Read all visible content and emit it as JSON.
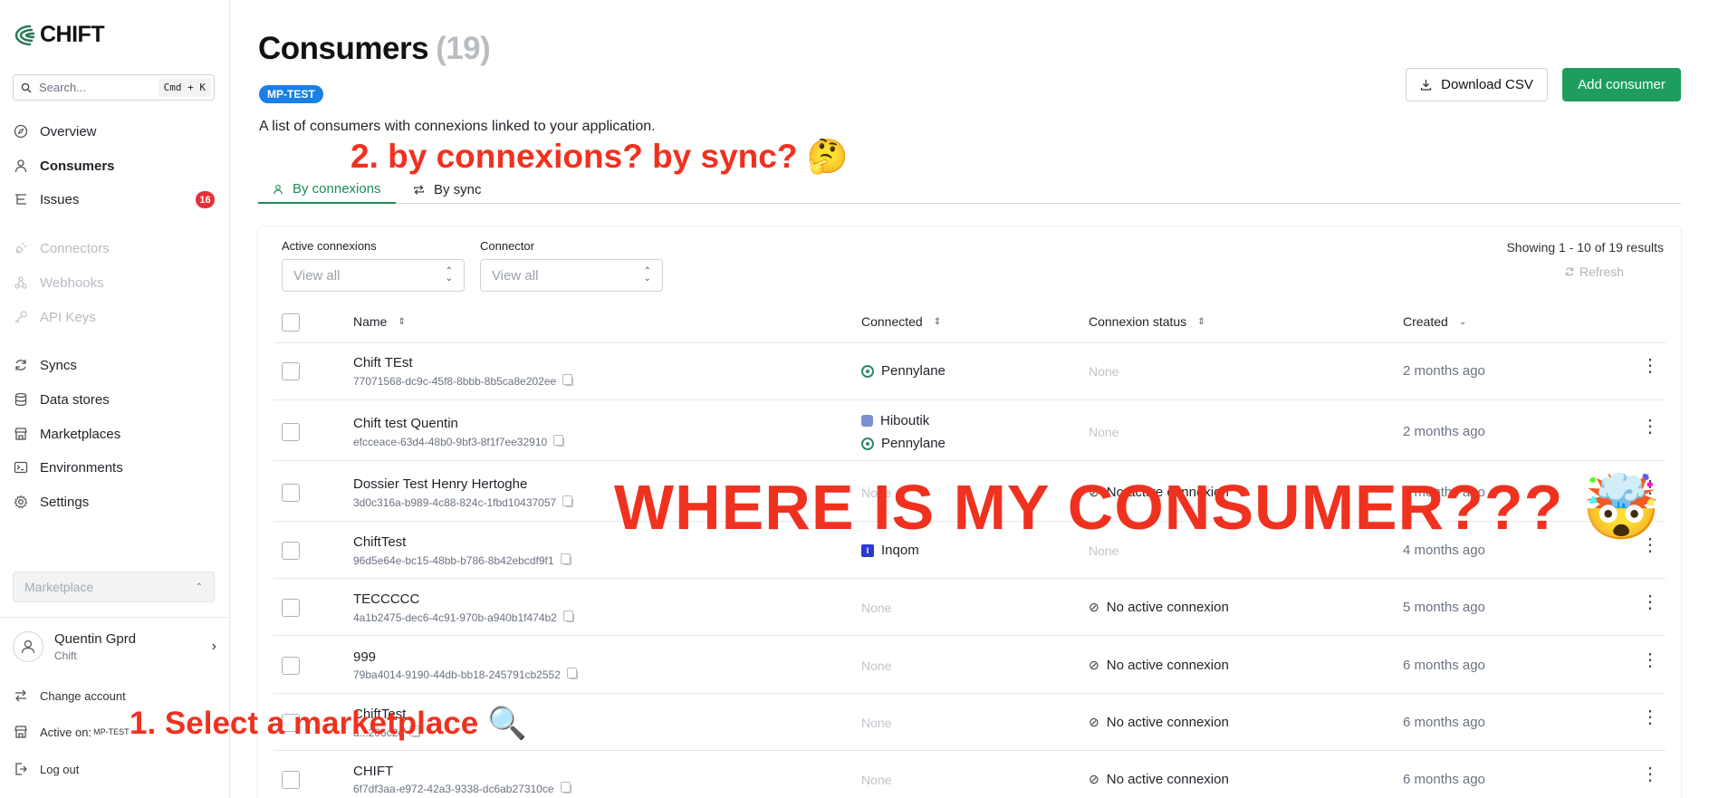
{
  "app": {
    "logo_text": "CHIFT"
  },
  "sidebar": {
    "search": {
      "placeholder": "Search...",
      "shortcut": "Cmd + K"
    },
    "items": [
      {
        "label": "Overview",
        "icon": "compass-icon",
        "state": "normal"
      },
      {
        "label": "Consumers",
        "icon": "user-icon",
        "state": "active"
      },
      {
        "label": "Issues",
        "icon": "issues-icon",
        "state": "normal",
        "badge": "16"
      },
      {
        "label": "Connectors",
        "icon": "plug-icon",
        "state": "disabled"
      },
      {
        "label": "Webhooks",
        "icon": "webhook-icon",
        "state": "disabled"
      },
      {
        "label": "API Keys",
        "icon": "key-icon",
        "state": "disabled"
      },
      {
        "label": "Syncs",
        "icon": "sync-icon",
        "state": "normal"
      },
      {
        "label": "Data stores",
        "icon": "database-icon",
        "state": "normal"
      },
      {
        "label": "Marketplaces",
        "icon": "store-icon",
        "state": "normal"
      },
      {
        "label": "Environments",
        "icon": "terminal-icon",
        "state": "normal"
      },
      {
        "label": "Settings",
        "icon": "gear-icon",
        "state": "normal"
      }
    ],
    "marketplace_select": {
      "placeholder": "Marketplace"
    },
    "user": {
      "name": "Quentin Gprd",
      "org": "Chift"
    },
    "change_account": "Change account",
    "active_on": {
      "label": "Active on:",
      "env": "MP-TEST"
    },
    "logout": "Log out"
  },
  "header": {
    "title": "Consumers",
    "count": "(19)",
    "env_tag": "MP-TEST",
    "subtitle": "A list of consumers with connexions linked to your application.",
    "download_csv": "Download CSV",
    "add_consumer": "Add consumer"
  },
  "tabs": [
    {
      "label": "By connexions",
      "active": true
    },
    {
      "label": "By sync",
      "active": false
    }
  ],
  "filters": {
    "active_connexions": {
      "label": "Active connexions",
      "value": "View all"
    },
    "connector": {
      "label": "Connector",
      "value": "View all"
    }
  },
  "results": {
    "showing": "Showing 1 - 10 of 19 results",
    "refresh": "Refresh"
  },
  "table": {
    "columns": [
      "Name",
      "Connected",
      "Connexion status",
      "Created"
    ],
    "rows": [
      {
        "name": "Chift TEst",
        "id": "77071568-dc9c-45f8-8bbb-8b5ca8e202ee",
        "connected": [
          {
            "name": "Pennylane",
            "icon": "pennylane-icon"
          }
        ],
        "status": "None",
        "created": "2 months ago"
      },
      {
        "name": "Chift test Quentin",
        "id": "efcceace-63d4-48b0-9bf3-8f1f7ee32910",
        "connected": [
          {
            "name": "Hiboutik",
            "icon": "hiboutik-icon"
          },
          {
            "name": "Pennylane",
            "icon": "pennylane-icon"
          }
        ],
        "status": "None",
        "created": "2 months ago"
      },
      {
        "name": "Dossier Test Henry Hertoghe",
        "id": "3d0c316a-b989-4c88-824c-1fbd10437057",
        "connected": [],
        "connected_none": "None",
        "status": "No active connexion",
        "created": "3 months ago"
      },
      {
        "name": "ChiftTest",
        "id": "96d5e64e-bc15-48bb-b786-8b42ebcdf9f1",
        "connected": [
          {
            "name": "Inqom",
            "icon": "inqom-icon"
          }
        ],
        "status": "None",
        "created": "4 months ago"
      },
      {
        "name": "TECCCCC",
        "id": "4a1b2475-dec6-4c91-970b-a940b1f474b2",
        "connected": [],
        "connected_none": "None",
        "status": "No active connexion",
        "created": "5 months ago"
      },
      {
        "name": "999",
        "id": "79ba4014-9190-44db-bb18-245791cb2552",
        "connected": [],
        "connected_none": "None",
        "status": "No active connexion",
        "created": "6 months ago"
      },
      {
        "name": "ChiftTest",
        "id": "a...206c2c",
        "connected": [],
        "connected_none": "None",
        "status": "No active connexion",
        "created": "6 months ago"
      },
      {
        "name": "CHIFT",
        "id": "6f7df3aa-e972-42a3-9338-dc6ab27310ce",
        "connected": [],
        "connected_none": "None",
        "status": "No active connexion",
        "created": "6 months ago"
      }
    ]
  },
  "annotations": {
    "step1": "1. Select a marketplace 🔍",
    "step2": "2. by connexions? by sync? 🤔",
    "main": "WHERE IS MY CONSUMER??? 🤯"
  },
  "colors": {
    "accent_green": "#1e9e5e",
    "tab_green": "#1e8a57",
    "tag_blue": "#1a7fe6",
    "badge_red": "#e5303a",
    "annotation_red": "#f0311f"
  }
}
